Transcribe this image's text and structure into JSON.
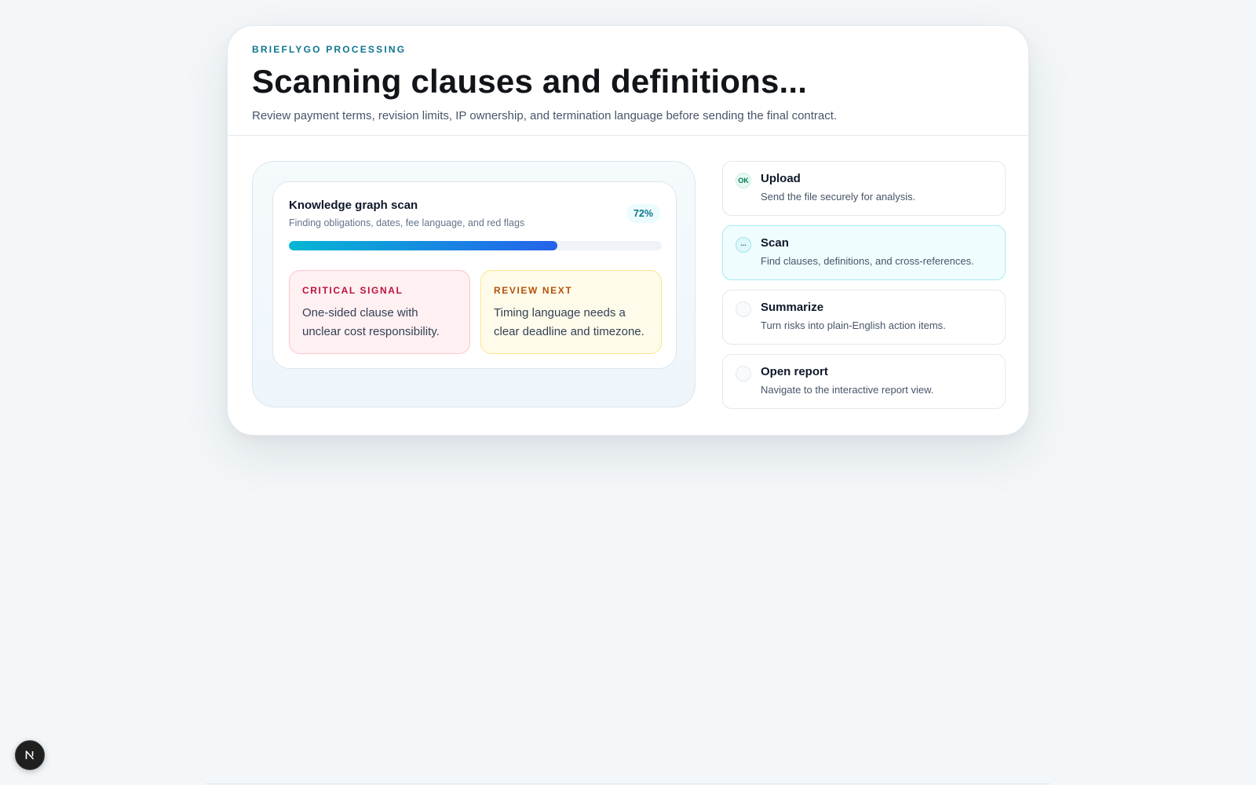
{
  "header": {
    "eyebrow": "BRIEFLYGO PROCESSING",
    "title": "Scanning clauses and definitions...",
    "subtitle": "Review payment terms, revision limits, IP ownership, and termination language before sending the final contract."
  },
  "scan": {
    "title": "Knowledge graph scan",
    "description": "Finding obligations, dates, fee language, and red flags",
    "percent_label": "72%",
    "progress_fraction": 0.72,
    "signals": [
      {
        "label": "CRITICAL SIGNAL",
        "text": "One-sided clause with unclear cost responsibility."
      },
      {
        "label": "REVIEW NEXT",
        "text": "Timing language needs a clear deadline and timezone."
      }
    ]
  },
  "steps": [
    {
      "icon": "OK",
      "state": "done",
      "name": "Upload",
      "description": "Send the file securely for analysis."
    },
    {
      "icon": "...",
      "state": "active",
      "name": "Scan",
      "description": "Find clauses, definitions, and cross-references."
    },
    {
      "icon": "",
      "state": "pending",
      "name": "Summarize",
      "description": "Turn risks into plain-English action items."
    },
    {
      "icon": "",
      "state": "pending",
      "name": "Open report",
      "description": "Navigate to the interactive report view."
    }
  ],
  "colors": {
    "accent": "#0e7490",
    "progress_start": "#06b6d4",
    "progress_end": "#2563eb",
    "critical": "#be123c",
    "review": "#b45309"
  },
  "dev_badge_icon": "nextjs-logo-icon"
}
